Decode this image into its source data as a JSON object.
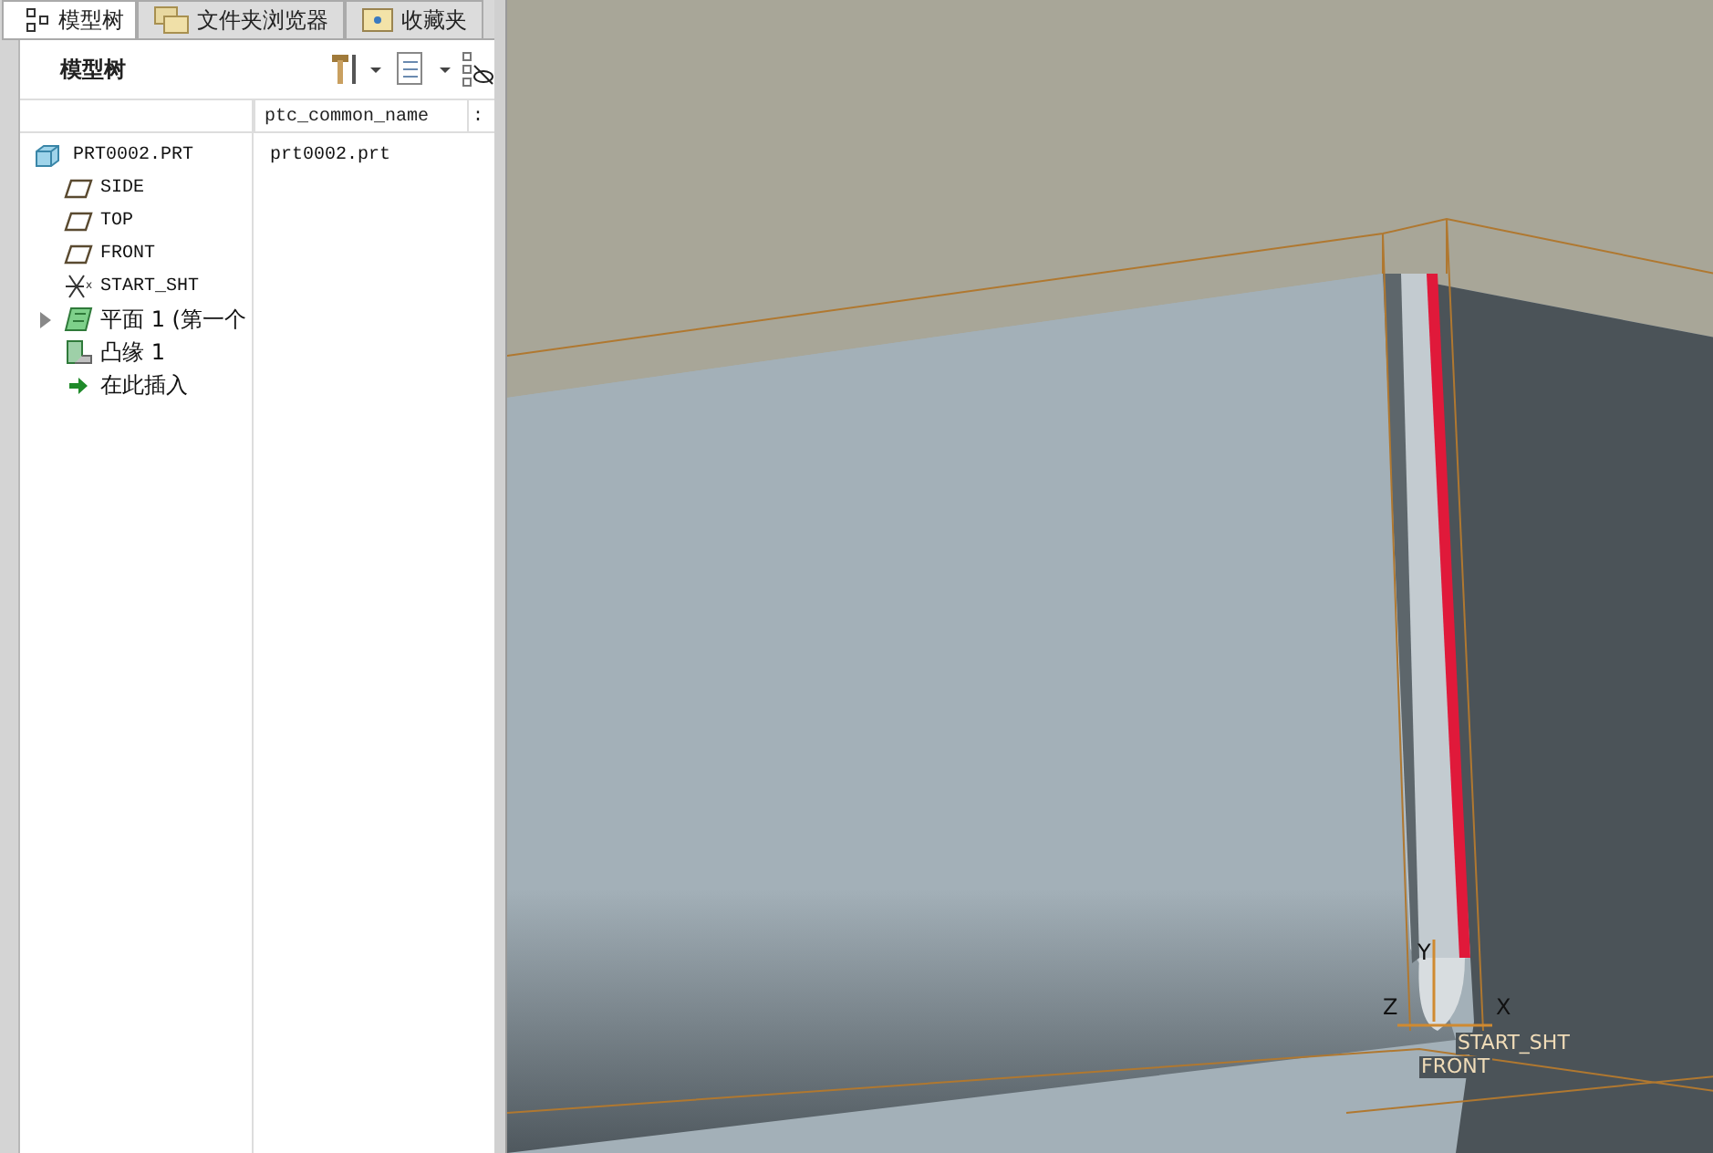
{
  "tabs": [
    {
      "label": "模型树",
      "kind": "tree",
      "selected": true
    },
    {
      "label": "文件夹浏览器",
      "kind": "folders",
      "selected": false
    },
    {
      "label": "收藏夹",
      "kind": "favorites",
      "selected": false
    }
  ],
  "panel": {
    "title": "模型树"
  },
  "columns": [
    "ptc_common_name",
    ":"
  ],
  "tree": [
    {
      "label": "PRT0002.PRT",
      "kind": "part",
      "value": "prt0002.prt",
      "children": [
        {
          "label": "SIDE",
          "kind": "plane"
        },
        {
          "label": "TOP",
          "kind": "plane"
        },
        {
          "label": "FRONT",
          "kind": "plane"
        },
        {
          "label": "START_SHT",
          "kind": "csys"
        },
        {
          "label": "平面 1 (第一个",
          "kind": "wall",
          "expanded": false
        },
        {
          "label": "凸缘 1",
          "kind": "flange"
        },
        {
          "label": "在此插入",
          "kind": "insert"
        }
      ]
    }
  ],
  "viewport": {
    "axis_labels": [
      {
        "label": "Y",
        "kind": "y"
      },
      {
        "label": "Z",
        "kind": "z"
      },
      {
        "label": "X",
        "kind": "x"
      }
    ],
    "datum_labels": [
      "START_SHT",
      "FRONT"
    ]
  }
}
